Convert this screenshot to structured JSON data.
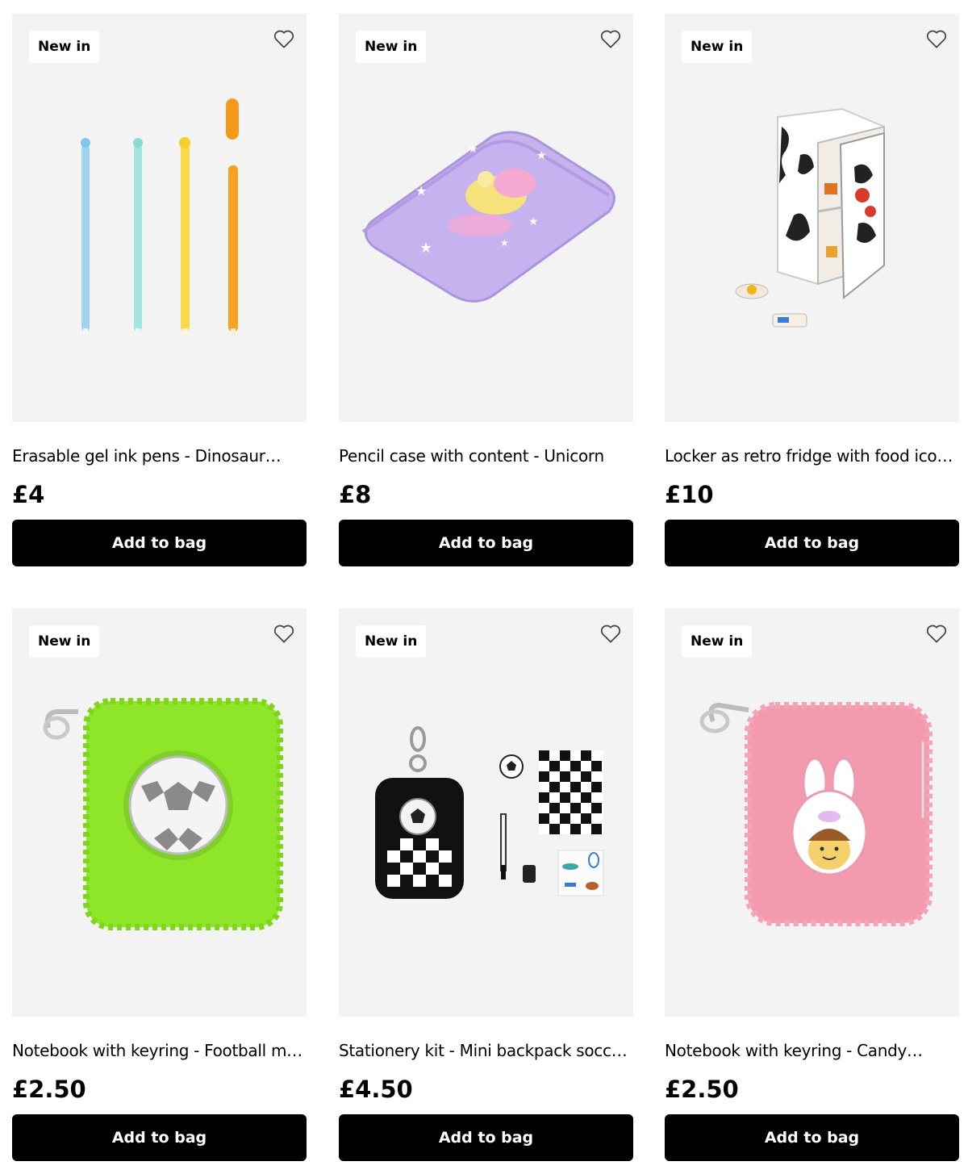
{
  "products": [
    {
      "badge": "New in",
      "title": "Erasable gel ink pens - Dinosaur…",
      "price": "£4",
      "cta": "Add to bag",
      "image": "pens-image"
    },
    {
      "badge": "New in",
      "title": "Pencil case with content - Unicorn",
      "price": "£8",
      "cta": "Add to bag",
      "image": "pencil-case-image"
    },
    {
      "badge": "New in",
      "title": "Locker as retro fridge with food icon…",
      "price": "£10",
      "cta": "Add to bag",
      "image": "fridge-locker-image"
    },
    {
      "badge": "New in",
      "title": "Notebook with keyring - Football motif",
      "price": "£2.50",
      "cta": "Add to bag",
      "image": "green-notebook-image"
    },
    {
      "badge": "New in",
      "title": "Stationery kit - Mini backpack soccer…",
      "price": "£4.50",
      "cta": "Add to bag",
      "image": "stationery-kit-image"
    },
    {
      "badge": "New in",
      "title": "Notebook with keyring - Candy…",
      "price": "£2.50",
      "cta": "Add to bag",
      "image": "pink-notebook-image"
    }
  ],
  "icons": {
    "wishlist": "heart-outline-icon"
  },
  "colors": {
    "button_bg": "#000000",
    "image_bg": "#f3f3f3",
    "badge_bg": "#ffffff"
  }
}
